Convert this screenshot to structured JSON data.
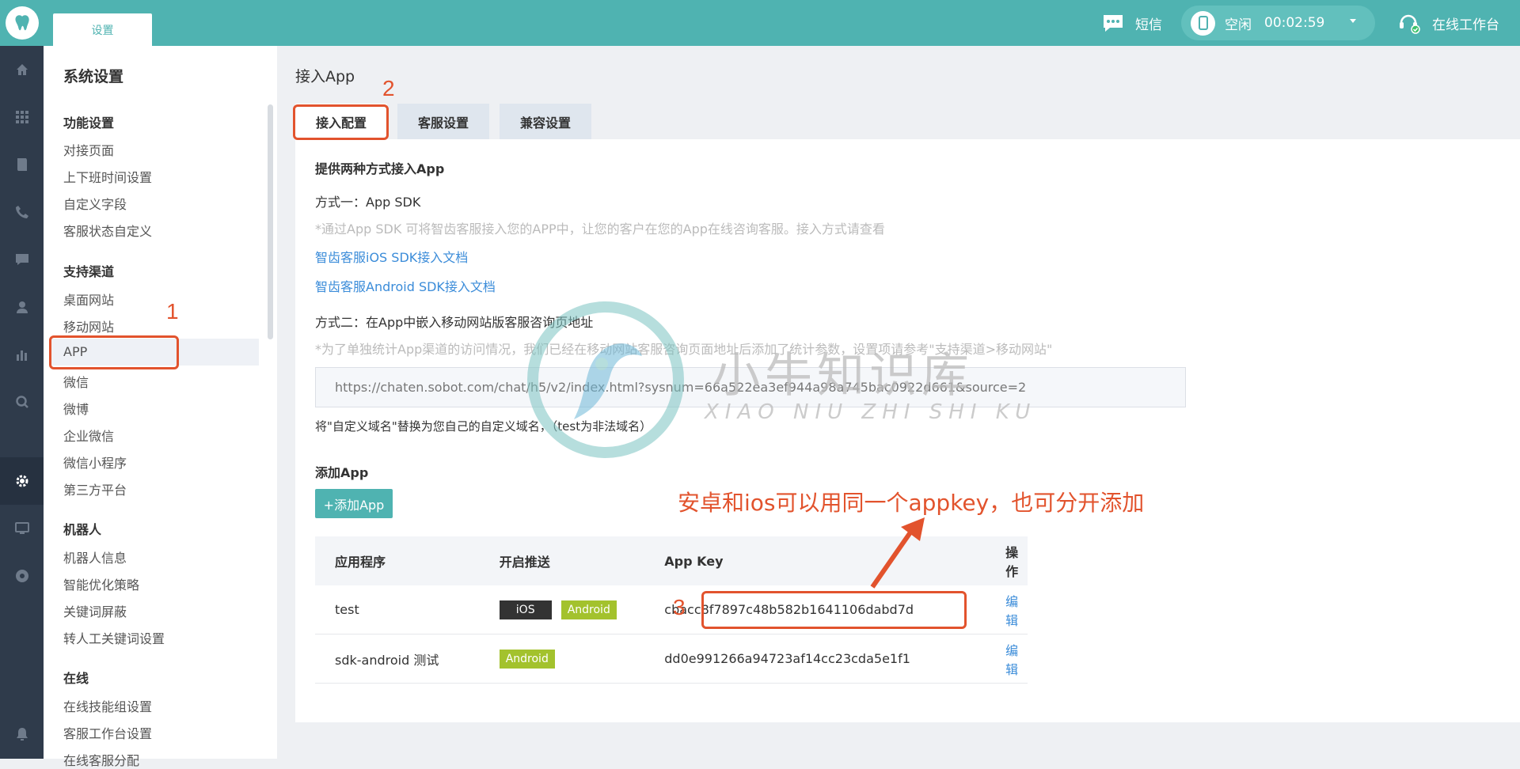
{
  "topbar": {
    "tab_label": "设置",
    "sms_label": "短信",
    "status_label": "空闲",
    "timer": "00:02:59",
    "workbench_label": "在线工作台"
  },
  "sidebar": {
    "title": "系统设置",
    "groups": [
      {
        "label": "功能设置",
        "items": [
          "对接页面",
          "上下班时间设置",
          "自定义字段",
          "客服状态自定义"
        ]
      },
      {
        "label": "支持渠道",
        "items": [
          "桌面网站",
          "移动网站",
          "APP",
          "微信",
          "微博",
          "企业微信",
          "微信小程序",
          "第三方平台"
        ]
      },
      {
        "label": "机器人",
        "items": [
          "机器人信息",
          "智能优化策略",
          "关键词屏蔽",
          "转人工关键词设置"
        ]
      },
      {
        "label": "在线",
        "items": [
          "在线技能组设置",
          "客服工作台设置",
          "在线客服分配"
        ]
      }
    ]
  },
  "main": {
    "title": "接入App",
    "tabs": [
      "接入配置",
      "客服设置",
      "兼容设置"
    ],
    "heading": "提供两种方式接入App",
    "method1": "方式一：App SDK",
    "method1_hint": "*通过App SDK 可将智齿客服接入您的APP中，让您的客户在您的App在线咨询客服。接入方式请查看",
    "link_ios": "智齿客服iOS SDK接入文档",
    "link_android": "智齿客服Android SDK接入文档",
    "method2": "方式二：在App中嵌入移动网站版客服咨询页地址",
    "method2_hint": "*为了单独统计App渠道的访问情况，我们已经在移动网站客服咨询页面地址后添加了统计参数，设置项请参考\"支持渠道>移动网站\"",
    "url": "https://chaten.sobot.com/chat/h5/v2/index.html?sysnum=66a522ea3ef944a98a745bac0922d661&source=2",
    "url_note": "将\"自定义域名\"替换为您自己的自定义域名，（test为非法域名）",
    "add_heading": "添加App",
    "add_button": "+添加App",
    "table": {
      "headers": [
        "应用程序",
        "开启推送",
        "App Key",
        "操作"
      ],
      "rows": [
        {
          "name": "test",
          "ios": "iOS",
          "android": "Android",
          "key": "cbacc8f7897c48b582b1641106dabd7d",
          "action": "编辑"
        },
        {
          "name": "sdk-android 测试",
          "android": "Android",
          "key": "dd0e991266a94723af14cc23cda5e1f1",
          "action": "编辑"
        }
      ]
    }
  },
  "annotations": {
    "n1": "1",
    "n2": "2",
    "n3": "3",
    "note": "安卓和ios可以用同一个appkey，也可分开添加"
  },
  "watermark": {
    "text": "小牛知识库",
    "sub": "XIAO NIU ZHI SHI KU"
  },
  "colors": {
    "brand": "#4fb3b1",
    "rail": "#2f3b4b",
    "link": "#3b8cd9",
    "annotation": "#e2532d",
    "android": "#a3c22d"
  }
}
